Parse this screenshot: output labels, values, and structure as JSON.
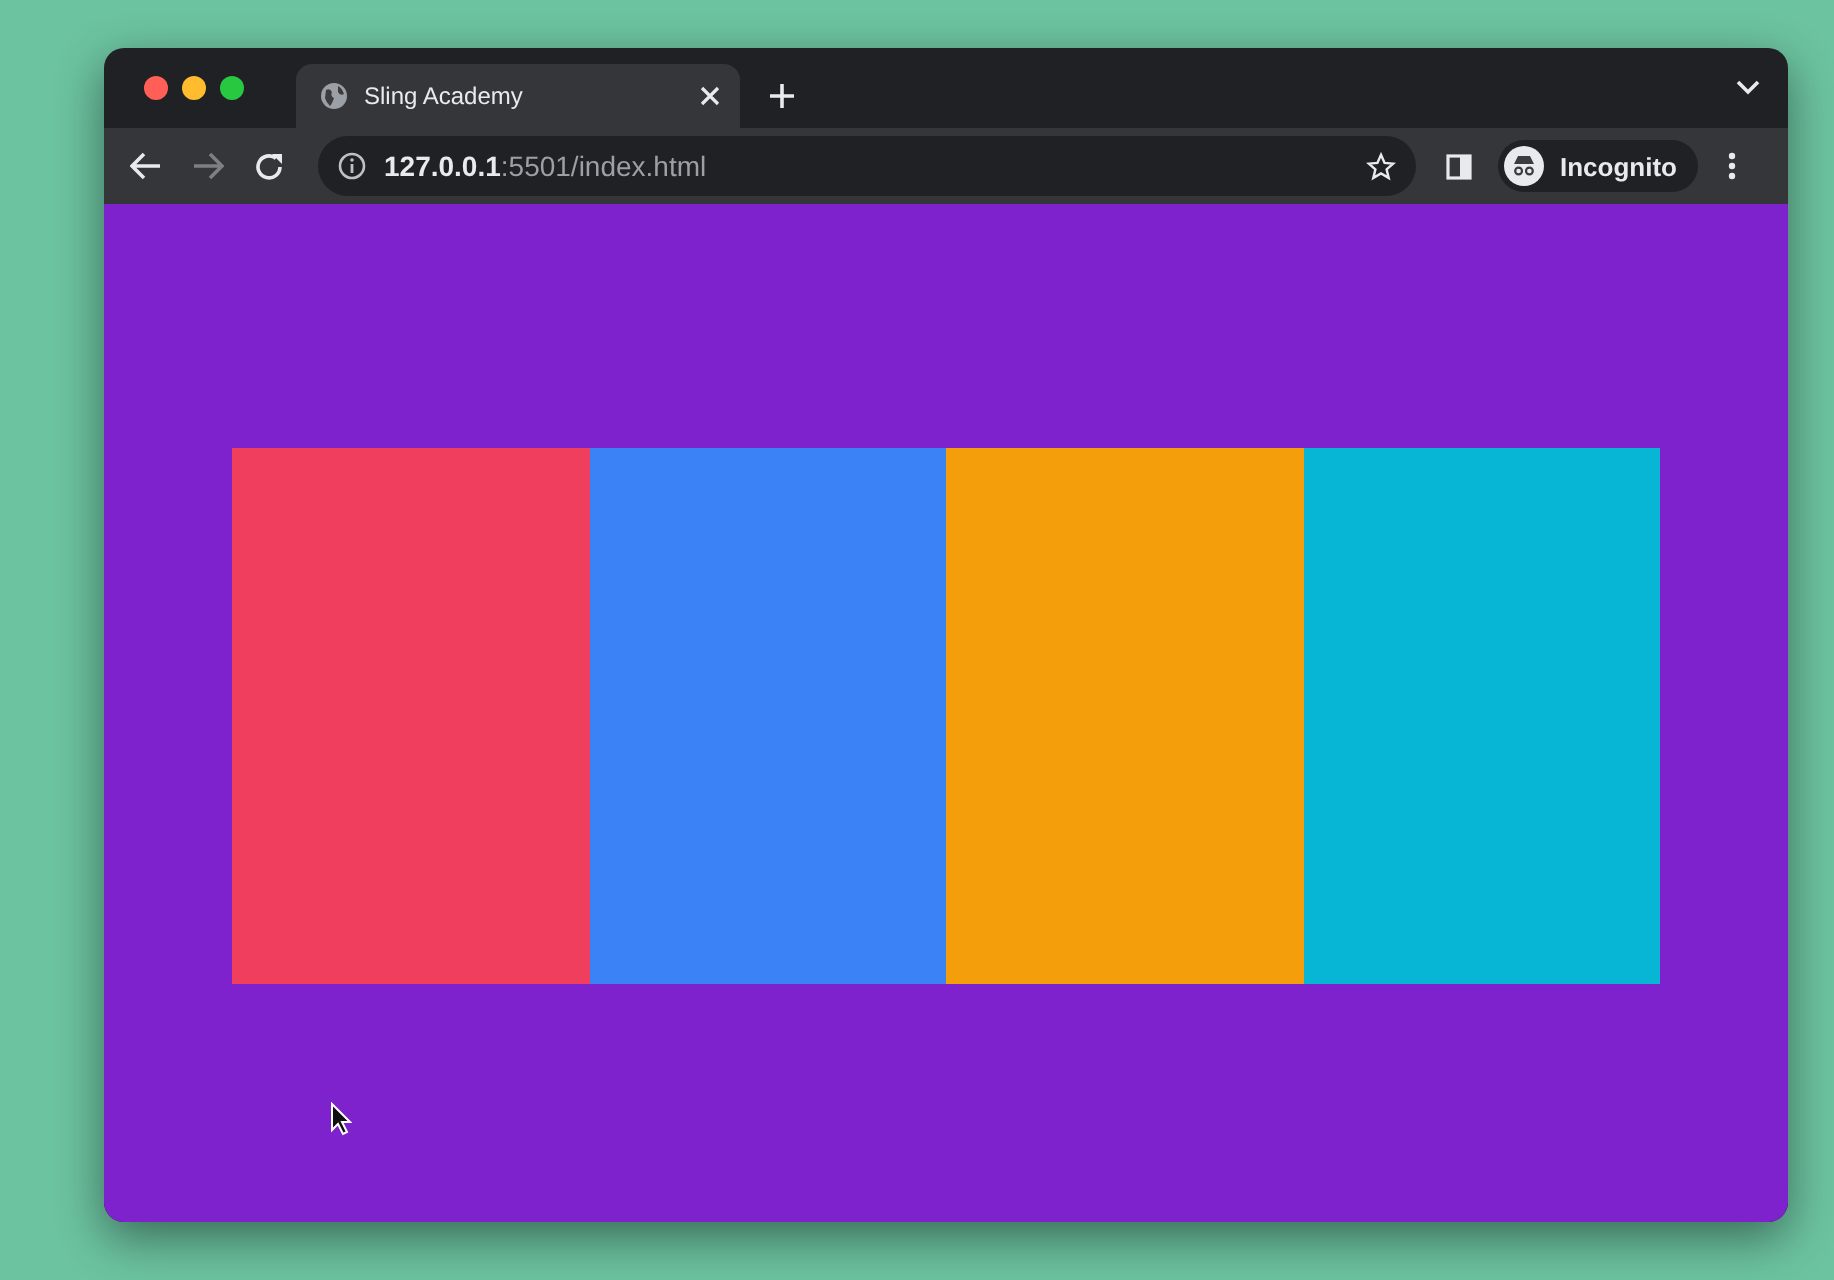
{
  "window": {
    "tab": {
      "title": "Sling Academy",
      "selected": true
    }
  },
  "toolbar": {
    "url_host": "127.0.0.1",
    "url_path": ":5501/index.html",
    "profile": "Incognito",
    "forward_disabled": true
  },
  "boxes": [
    {
      "color": "#f03e5f"
    },
    {
      "color": "#3b82f6"
    },
    {
      "color": "#f49e0b"
    },
    {
      "color": "#06b6d4"
    }
  ]
}
